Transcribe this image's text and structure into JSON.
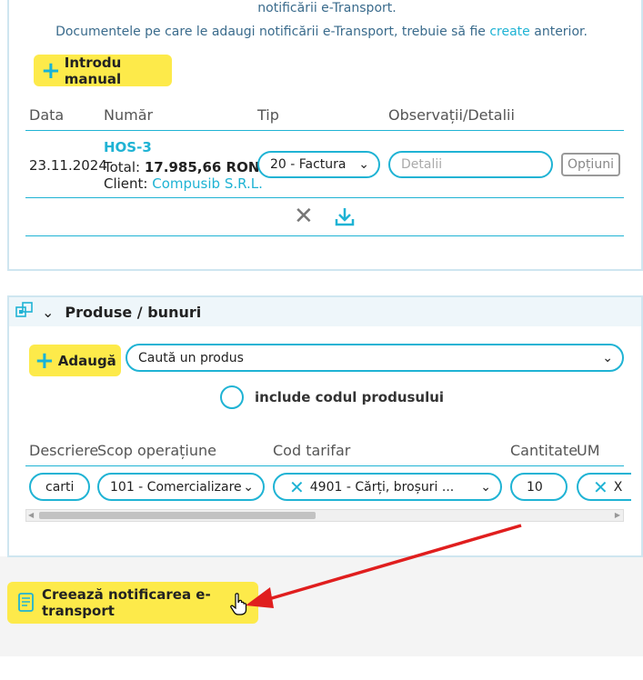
{
  "header_text": {
    "line1": "notificării e-Transport.",
    "line2_pre": "Documentele pe care le adaugi notificării e-Transport, trebuie să fie",
    "line2_link": "create",
    "line2_post": "anterior."
  },
  "manual_button": {
    "label": "Introdu manual"
  },
  "docs_table": {
    "headers": [
      "Data",
      "Număr",
      "Tip",
      "Observații/Detalii"
    ],
    "row": {
      "date": "23.11.2024",
      "number": "HOS-3",
      "total_label": "Total:",
      "total_value": "17.985,66 RON",
      "client_label": "Client:",
      "client_value": "Compusib S.R.L.",
      "type": "20 - Factura",
      "details_placeholder": "Detalii",
      "options_label": "Opțiuni"
    }
  },
  "products_panel": {
    "title": "Produse / bunuri",
    "add_label": "Adaugă",
    "search_placeholder": "Caută un produs",
    "include_code_label": "include codul produsului",
    "headers": [
      "Descriere",
      "Scop operațiune",
      "Cod tarifar",
      "Cantitate",
      "UM"
    ],
    "row": {
      "description": "carti",
      "purpose": "101 - Comercializare",
      "tariff_code": "4901 - Cărți, broșuri ...",
      "quantity": "10",
      "um": "X"
    }
  },
  "create_button": {
    "label": "Creează notificarea e-transport"
  },
  "colors": {
    "accent": "#1fb3d4",
    "yellow": "#fdea4a",
    "arrow": "#e01e1e"
  }
}
